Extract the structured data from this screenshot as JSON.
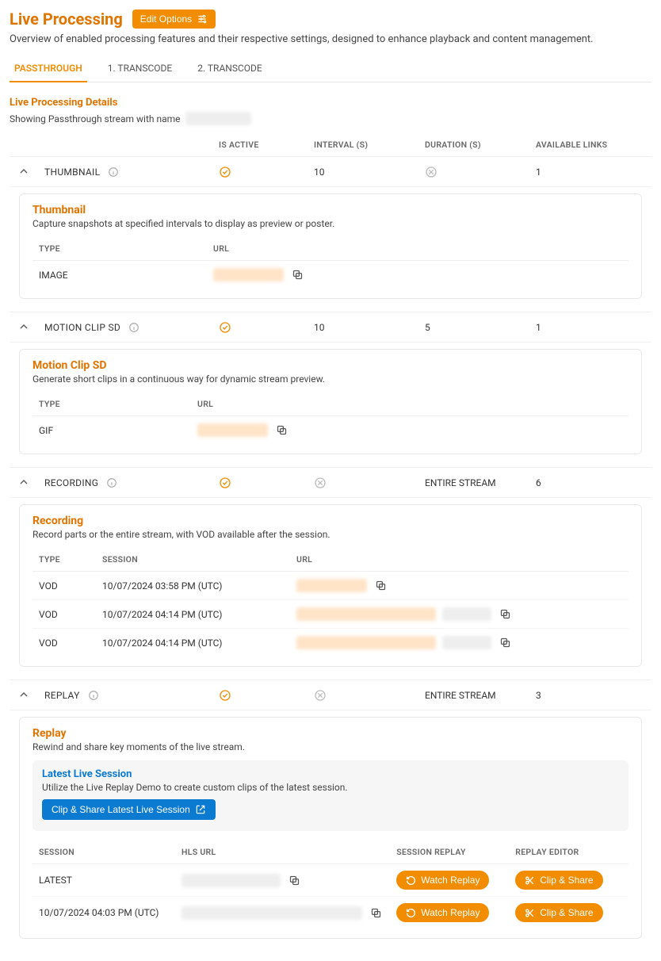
{
  "header": {
    "title": "Live Processing",
    "edit_button": "Edit Options",
    "overview": "Overview of enabled processing features and their respective settings, designed to enhance playback and content management."
  },
  "tabs": [
    {
      "id": "passthrough",
      "label": "PASSTHROUGH",
      "active": true
    },
    {
      "id": "transcode1",
      "label": "1. TRANSCODE",
      "active": false
    },
    {
      "id": "transcode2",
      "label": "2. TRANSCODE",
      "active": false
    }
  ],
  "details_header": {
    "title": "Live Processing Details",
    "subtitle_prefix": "Showing Passthrough stream with name",
    "stream_name": "redacted"
  },
  "outer_columns": {
    "name": "",
    "is_active": "IS ACTIVE",
    "interval": "INTERVAL (S)",
    "duration": "DURATION (S)",
    "available_links": "AVAILABLE LINKS"
  },
  "rows": [
    {
      "id": "thumbnail",
      "name": "THUMBNAIL",
      "is_active": true,
      "interval": "10",
      "duration": null,
      "links": "1",
      "detail": {
        "title": "Thumbnail",
        "desc": "Capture snapshots at specified intervals to display as preview or poster.",
        "columns": {
          "type": "TYPE",
          "url": "URL"
        },
        "items": [
          {
            "type": "IMAGE",
            "url_masked": true
          }
        ]
      }
    },
    {
      "id": "motionclip",
      "name": "MOTION CLIP SD",
      "is_active": true,
      "interval": "10",
      "duration": "5",
      "links": "1",
      "detail": {
        "title": "Motion Clip SD",
        "desc": "Generate short clips in a continuous way for dynamic stream preview.",
        "columns": {
          "type": "TYPE",
          "url": "URL"
        },
        "items": [
          {
            "type": "GIF",
            "url_masked": true
          }
        ]
      }
    },
    {
      "id": "recording",
      "name": "RECORDING",
      "is_active": true,
      "interval": null,
      "duration": "ENTIRE STREAM",
      "links": "6",
      "detail": {
        "title": "Recording",
        "desc": "Record parts or the entire stream, with VOD available after the session.",
        "columns": {
          "type": "TYPE",
          "session": "SESSION",
          "url": "URL"
        },
        "items": [
          {
            "type": "VOD",
            "session": "10/07/2024 03:58 PM (UTC)",
            "url_masked": true,
            "url_tail": ""
          },
          {
            "type": "VOD",
            "session": "10/07/2024 04:14 PM (UTC)",
            "url_masked": true,
            "url_tail": "redacted"
          },
          {
            "type": "VOD",
            "session": "10/07/2024 04:14 PM (UTC)",
            "url_masked": true,
            "url_tail": "redacted"
          }
        ]
      }
    },
    {
      "id": "replay",
      "name": "REPLAY",
      "is_active": true,
      "interval": null,
      "duration": "ENTIRE STREAM",
      "links": "3",
      "detail": {
        "title": "Replay",
        "desc": "Rewind and share key moments of the live stream.",
        "callout": {
          "title": "Latest Live Session",
          "desc": "Utilize the Live Replay Demo to create custom clips of the latest session.",
          "button": "Clip & Share Latest Live Session"
        },
        "columns": {
          "session": "SESSION",
          "hls": "HLS URL",
          "session_replay": "SESSION REPLAY",
          "editor": "REPLAY EDITOR"
        },
        "watch_label": "Watch Replay",
        "clip_label": "Clip & Share",
        "items": [
          {
            "session": "LATEST",
            "hls_masked": true,
            "tail": ""
          },
          {
            "session": "10/07/2024 04:03 PM (UTC)",
            "hls_masked": true,
            "tail": ""
          }
        ]
      }
    }
  ]
}
